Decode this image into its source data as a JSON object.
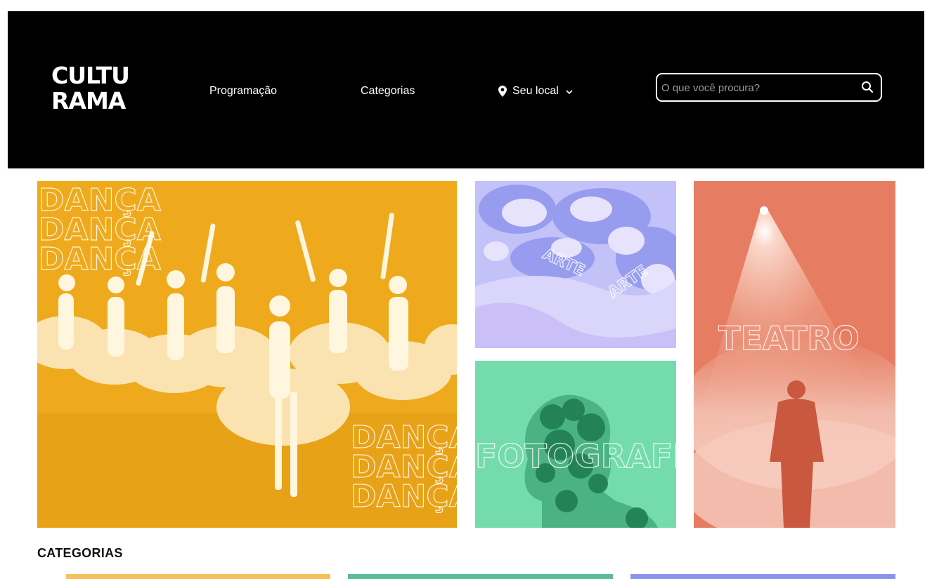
{
  "header": {
    "logo": {
      "line1": "CULTU",
      "line2": "RAMA"
    },
    "nav": {
      "programacao": "Programação",
      "categorias": "Categorias",
      "location": "Seu local"
    },
    "search": {
      "placeholder": "O que você procura?",
      "value": ""
    },
    "icons": {
      "location": "map-pin-icon",
      "dropdown": "chevron-down-icon",
      "search": "search-icon"
    }
  },
  "featured": {
    "tiles": [
      {
        "label": "DANÇA",
        "color": "#eeaa1c"
      },
      {
        "label": "ARTE",
        "color": "#c2c2f8"
      },
      {
        "label": "FOTOGRAFIA",
        "color": "#74dcac"
      },
      {
        "label": "TEATRO",
        "color": "#e67d63"
      }
    ]
  },
  "categories": {
    "title": "CATEGORIAS",
    "colors": [
      "#f6c15a",
      "#5bbd93",
      "#8c93ee"
    ]
  }
}
